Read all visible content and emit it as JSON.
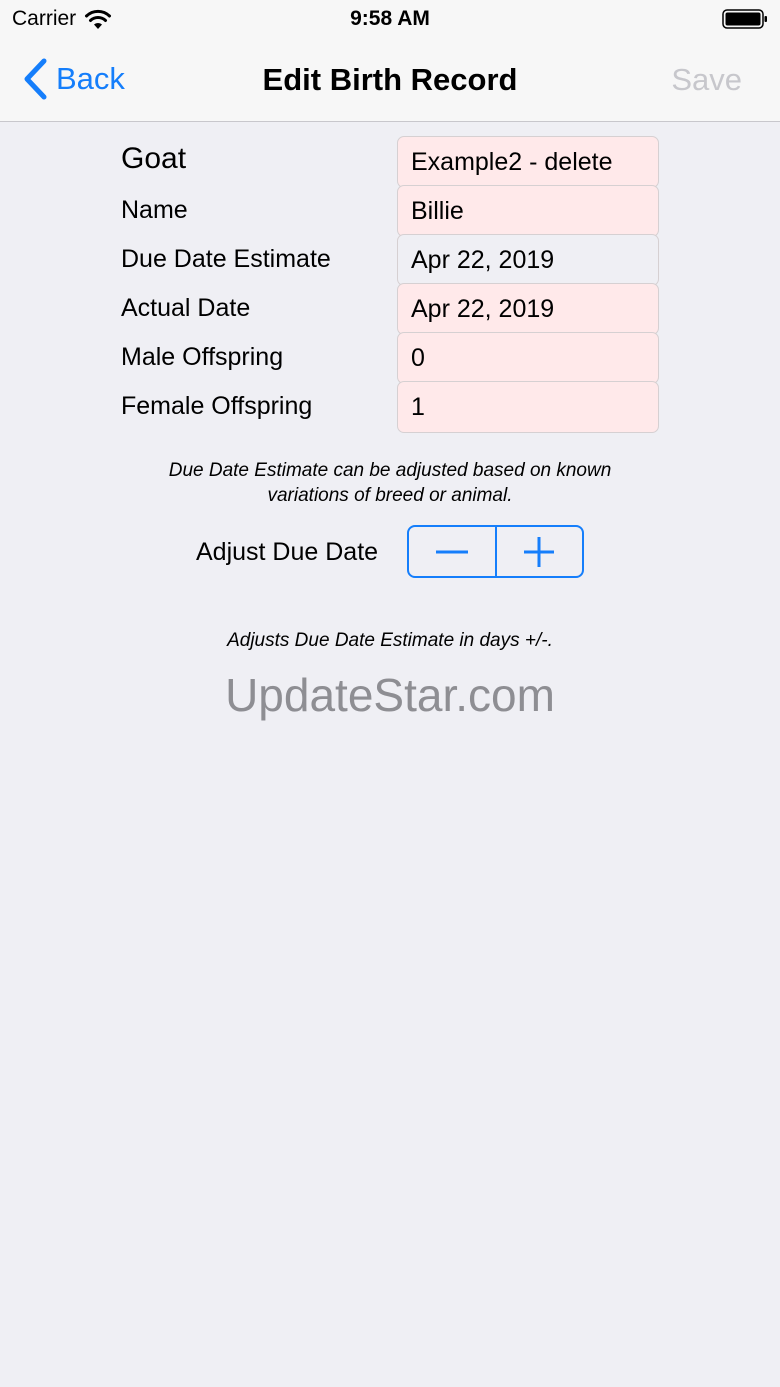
{
  "status_bar": {
    "carrier": "Carrier",
    "time": "9:58 AM"
  },
  "nav": {
    "back_label": "Back",
    "title": "Edit Birth Record",
    "save_label": "Save"
  },
  "form": {
    "rows": [
      {
        "label": "Goat",
        "value": "Example2 - delete"
      },
      {
        "label": "Name",
        "value": "Billie"
      },
      {
        "label": "Due Date Estimate",
        "value": "Apr 22, 2019"
      },
      {
        "label": "Actual Date",
        "value": "Apr 22, 2019"
      },
      {
        "label": "Male Offspring",
        "value": "0"
      },
      {
        "label": "Female Offspring",
        "value": "1"
      }
    ]
  },
  "note_due_date": "Due Date Estimate can be adjusted based on known\nvariations of breed or animal.",
  "adjust": {
    "label": "Adjust Due Date",
    "note": "Adjusts Due Date Estimate in days +/-."
  },
  "watermark": "UpdateStar.com",
  "colors": {
    "accent": "#157efb",
    "field_pink": "#ffe9ea",
    "background": "#efeff4",
    "disabled": "#c7c7cc"
  },
  "icons": {
    "wifi": "wifi-icon",
    "battery": "battery-icon",
    "back": "chevron-left-icon",
    "minus": "minus-icon",
    "plus": "plus-icon"
  }
}
